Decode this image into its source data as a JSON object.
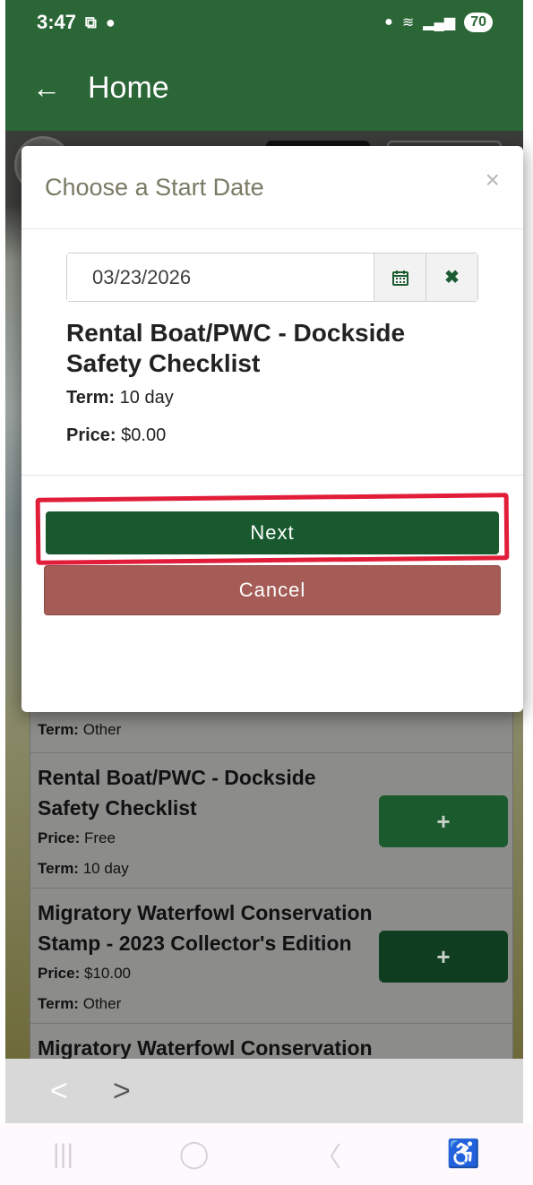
{
  "status_bar": {
    "time": "3:47",
    "battery": "70"
  },
  "header": {
    "title": "Home"
  },
  "modal": {
    "title": "Choose a Start Date",
    "close_label": "×",
    "date_value": "03/23/2026",
    "product_title": "Rental Boat/PWC - Dockside Safety Checklist",
    "term_label": "Term:",
    "term_value": "10 day",
    "price_label": "Price:",
    "price_value": "$0.00",
    "next_label": "Next",
    "cancel_label": "Cancel"
  },
  "background_list": {
    "items": [
      {
        "term_label": "Term:",
        "term_value": "Other"
      },
      {
        "title": "Rental Boat/PWC - Dockside Safety Checklist",
        "price_label": "Price:",
        "price_value": "Free",
        "term_label": "Term:",
        "term_value": "10 day",
        "add_label": "+"
      },
      {
        "title": "Migratory Waterfowl Conservation Stamp - 2023 Collector's Edition",
        "price_label": "Price:",
        "price_value": "$10.00",
        "term_label": "Term:",
        "term_value": "Other",
        "add_label": "+"
      },
      {
        "title": "Migratory Waterfowl Conservation"
      }
    ]
  },
  "browser_bar": {
    "back_label": "<",
    "forward_label": ">"
  },
  "icons": {
    "accent_green": "#2b6637",
    "button_green": "#185a2e",
    "cancel_red": "#a55c56",
    "highlight_red": "#e21d39"
  }
}
